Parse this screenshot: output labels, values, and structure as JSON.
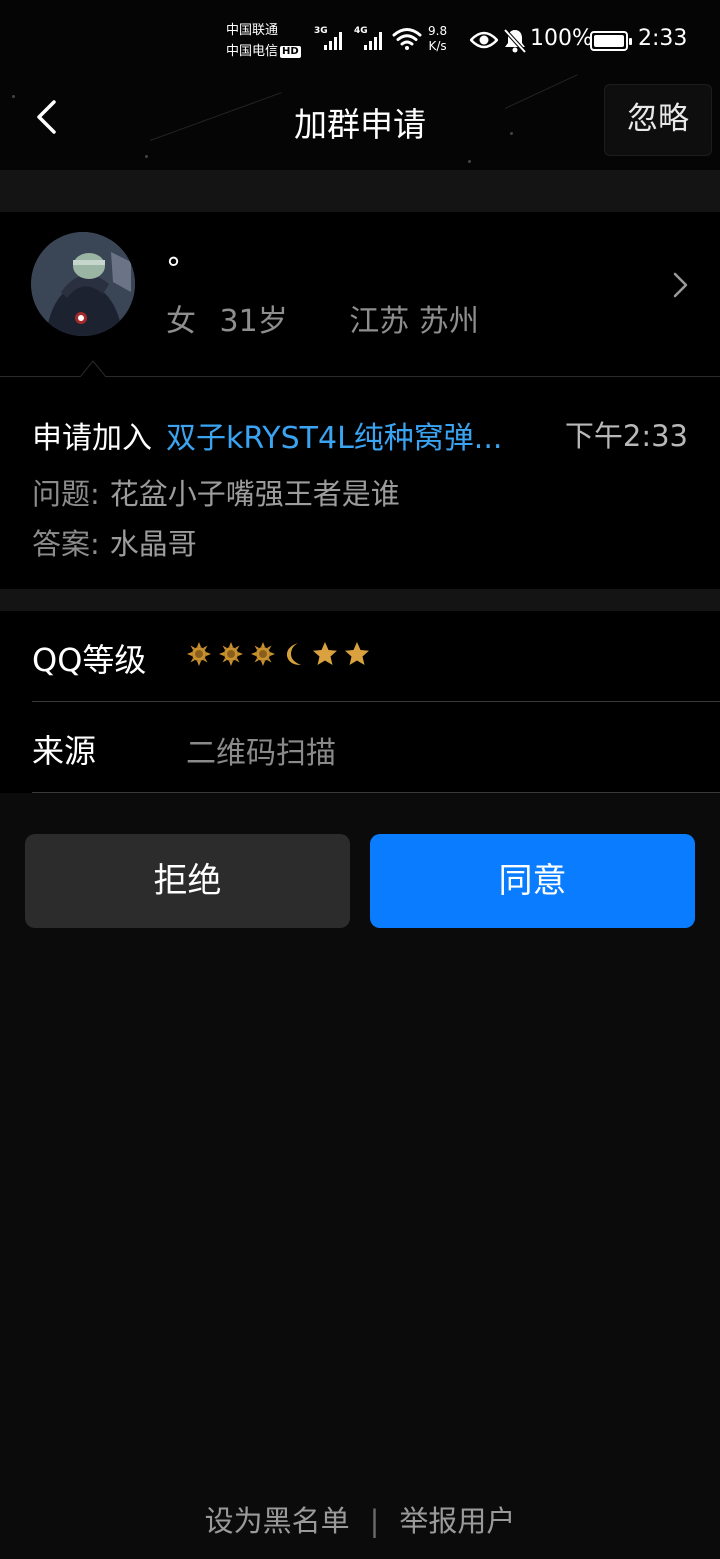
{
  "status_bar": {
    "carrier_1": "中国联通",
    "carrier_2": "中国电信",
    "hd_badge": "HD",
    "signal_1_label": "3G",
    "signal_2_label": "4G",
    "net_speed_value": "9.8",
    "net_speed_unit": "K/s",
    "battery_percent": "100%",
    "time": "2:33",
    "icons": [
      "signal-icon",
      "wifi-icon",
      "eye-icon",
      "bell-off-icon",
      "battery-icon"
    ]
  },
  "nav": {
    "title": "加群申请",
    "ignore_label": "忽略",
    "back_icon": "chevron-left-icon"
  },
  "profile": {
    "nickname": "°",
    "gender": "女",
    "age": "31岁",
    "location": "江苏 苏州"
  },
  "application": {
    "apply_prefix": "申请加入",
    "group_name": "双子kRYST4L纯种窝弹...",
    "time": "下午2:33",
    "question_label": "问题:",
    "question": "花盆小子嘴强王者是谁",
    "answer_label": "答案:",
    "answer": "水晶哥"
  },
  "info_rows": {
    "level_label": "QQ等级",
    "level_icons": [
      "sun-icon",
      "sun-icon",
      "sun-icon",
      "moon-icon",
      "star-icon",
      "star-icon"
    ],
    "source_label": "来源",
    "source_value": "二维码扫描"
  },
  "actions": {
    "reject_label": "拒绝",
    "accept_label": "同意"
  },
  "footer": {
    "blacklist_label": "设为黑名单",
    "separator": "|",
    "report_label": "举报用户"
  },
  "colors": {
    "accent": "#0a7cff",
    "link": "#3aa4f2",
    "background": "#0b0b0b",
    "reject_button": "#2c2c2c",
    "level_gold": "#c9902f"
  }
}
